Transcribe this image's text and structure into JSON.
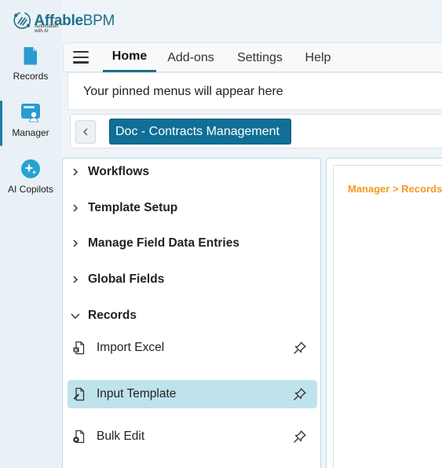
{
  "brand": {
    "name_part1": "Affable",
    "name_part2": "BPM",
    "tagline": "Automation with AI"
  },
  "rail": {
    "items": [
      {
        "label": "Records",
        "icon": "records-icon"
      },
      {
        "label": "Manager",
        "icon": "manager-icon",
        "active": true
      },
      {
        "label": "AI Copilots",
        "icon": "ai-copilots-icon"
      }
    ]
  },
  "topnav": {
    "tabs": [
      {
        "label": "Home",
        "active": true
      },
      {
        "label": "Add-ons"
      },
      {
        "label": "Settings"
      },
      {
        "label": "Help"
      }
    ]
  },
  "pinned_text": "Your pinned menus will appear here",
  "module": {
    "selected": "Doc - Contracts Management"
  },
  "menu": {
    "groups": [
      {
        "label": "Workflows",
        "expanded": false
      },
      {
        "label": "Template Setup",
        "expanded": false
      },
      {
        "label": "Manage Field Data Entries",
        "expanded": false
      },
      {
        "label": "Global Fields",
        "expanded": false
      },
      {
        "label": "Records",
        "expanded": true
      }
    ],
    "record_items": [
      {
        "label": "Import Excel",
        "selected": false
      },
      {
        "label": "Input Template",
        "selected": true
      },
      {
        "label": "Bulk Edit",
        "selected": false
      }
    ]
  },
  "content": {
    "breadcrumb": "Manager > Records"
  },
  "colors": {
    "primary": "#0f6f96",
    "accent_orange": "#f39a1d",
    "selected_bg": "#bfe3ec"
  }
}
